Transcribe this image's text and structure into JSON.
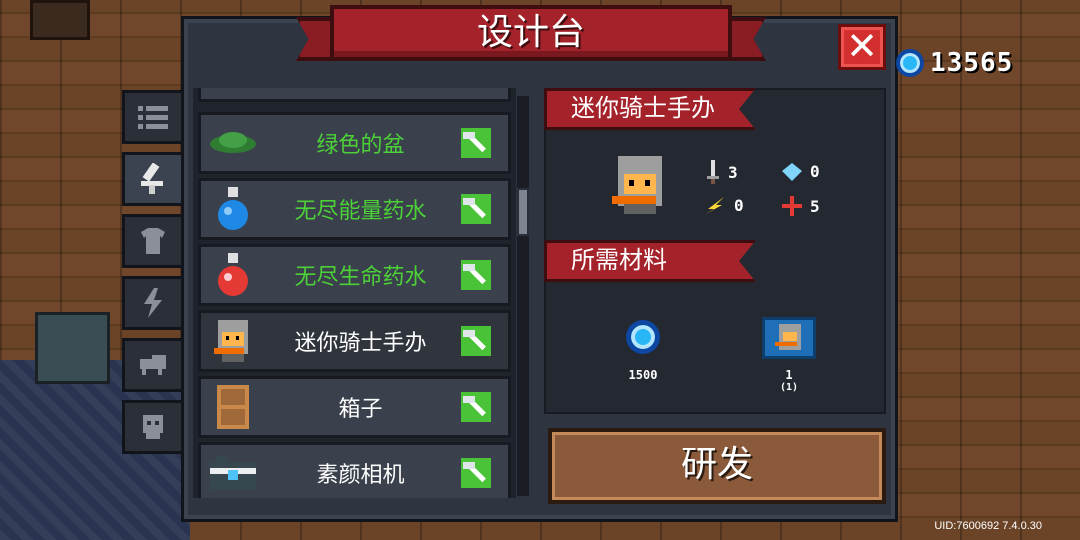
{
  "title": "设计台",
  "currency": {
    "amount": "13565",
    "icon": "gem-coin-icon",
    "color": "#29b6f6"
  },
  "side_tabs": [
    {
      "icon": "list-icon",
      "active": false
    },
    {
      "icon": "weapon-icon",
      "active": true
    },
    {
      "icon": "armor-icon",
      "active": false
    },
    {
      "icon": "lightning-icon",
      "active": false
    },
    {
      "icon": "pet-icon",
      "active": false
    },
    {
      "icon": "skull-icon",
      "active": false
    }
  ],
  "items": [
    {
      "name": "绿色的盆",
      "icon": "green-pot-icon",
      "crafted": true
    },
    {
      "name": "无尽能量药水",
      "icon": "blue-potion-icon",
      "crafted": true
    },
    {
      "name": "无尽生命药水",
      "icon": "red-potion-icon",
      "crafted": true
    },
    {
      "name": "迷你骑士手办",
      "icon": "knight-figure-icon",
      "crafted": false,
      "selected": true
    },
    {
      "name": "箱子",
      "icon": "box-icon",
      "crafted": false
    },
    {
      "name": "素颜相机",
      "icon": "camera-icon",
      "crafted": false
    }
  ],
  "detail": {
    "item_name": "迷你骑士手办",
    "stats": {
      "attack": "3",
      "crit": "0",
      "energy": "0",
      "accuracy": "5"
    },
    "materials_header": "所需材料",
    "materials": [
      {
        "icon": "gem-coin-icon",
        "label": "1500",
        "sub": ""
      },
      {
        "icon": "blueprint-icon",
        "label": "1",
        "sub": "(1)"
      }
    ]
  },
  "develop_button": "研发",
  "uid": "UID:7600692 7.4.0.30",
  "colors": {
    "accent_red": "#a4232b",
    "owned_green": "#4cd137",
    "button_brown": "#8a5a3a"
  }
}
